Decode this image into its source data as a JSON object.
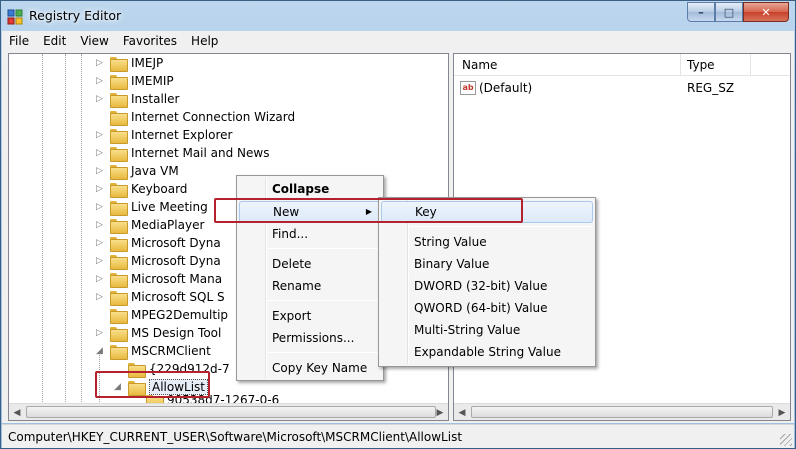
{
  "window": {
    "title": "Registry Editor",
    "buttons": {
      "minimize": "–",
      "maximize": "□",
      "close": "✕"
    }
  },
  "menubar": [
    "File",
    "Edit",
    "View",
    "Favorites",
    "Help"
  ],
  "tree": {
    "items": [
      {
        "label": "IMEJP",
        "expander": "▷"
      },
      {
        "label": "IMEMIP",
        "expander": "▷"
      },
      {
        "label": "Installer",
        "expander": "▷"
      },
      {
        "label": "Internet Connection Wizard",
        "expander": ""
      },
      {
        "label": "Internet Explorer",
        "expander": "▷"
      },
      {
        "label": "Internet Mail and News",
        "expander": "▷"
      },
      {
        "label": "Java VM",
        "expander": "▷"
      },
      {
        "label": "Keyboard",
        "expander": "▷"
      },
      {
        "label": "Live Meeting",
        "expander": "▷"
      },
      {
        "label": "MediaPlayer",
        "expander": "▷"
      },
      {
        "label": "Microsoft Dyna",
        "expander": "▷"
      },
      {
        "label": "Microsoft Dyna",
        "expander": "▷"
      },
      {
        "label": "Microsoft Mana",
        "expander": "▷"
      },
      {
        "label": "Microsoft SQL S",
        "expander": "▷"
      },
      {
        "label": "MPEG2Demultip",
        "expander": ""
      },
      {
        "label": "MS Design Tool",
        "expander": "▷"
      },
      {
        "label": "MSCRMClient",
        "expander": "◢"
      },
      {
        "label": "{229d912d-7",
        "expander": ""
      },
      {
        "label": "AllowList",
        "expander": "◢"
      },
      {
        "label": "90538d7-1267-0-6",
        "expander": ""
      }
    ]
  },
  "list": {
    "columns": [
      "Name",
      "Type"
    ],
    "rows": [
      {
        "icon": "ab",
        "name": "(Default)",
        "type": "REG_SZ"
      }
    ]
  },
  "context_menu": {
    "items": [
      "Collapse",
      "New",
      "Find...",
      "Delete",
      "Rename",
      "Export",
      "Permissions...",
      "Copy Key Name"
    ],
    "submenu_arrow": "▶"
  },
  "new_submenu": {
    "items": [
      "Key",
      "String Value",
      "Binary Value",
      "DWORD (32-bit) Value",
      "QWORD (64-bit) Value",
      "Multi-String Value",
      "Expandable String Value"
    ]
  },
  "status": {
    "path": "Computer\\HKEY_CURRENT_USER\\Software\\Microsoft\\MSCRMClient\\AllowList"
  },
  "colors": {
    "highlight_box": "#b3222d",
    "folder": "#e9b93f"
  }
}
